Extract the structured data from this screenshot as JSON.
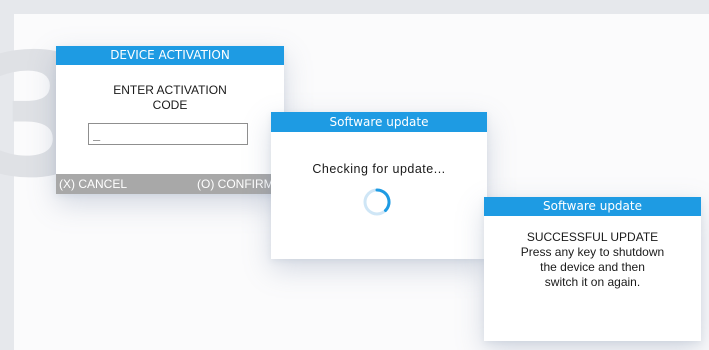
{
  "activation_screen": {
    "title": "DEVICE ACTIVATION",
    "heading_line1": "ENTER ACTIVATION",
    "heading_line2": "CODE",
    "code_value": "_",
    "cancel_label": "(X) CANCEL",
    "confirm_label": "(O) CONFIRM"
  },
  "checking_screen": {
    "title": "Software update",
    "message": "Checking for update..."
  },
  "success_screen": {
    "title": "Software update",
    "lines": [
      "SUCCESSFUL UPDATE",
      "Press any key to shutdown",
      "the device and then",
      "switch it on again."
    ]
  },
  "colors": {
    "title_bar": "#1e9be3",
    "footer": "#a8a8a8",
    "spinner_track": "#cfe6f6",
    "spinner_arc": "#1e9be3"
  },
  "icons": {
    "spinner": "loading-spinner-icon"
  }
}
